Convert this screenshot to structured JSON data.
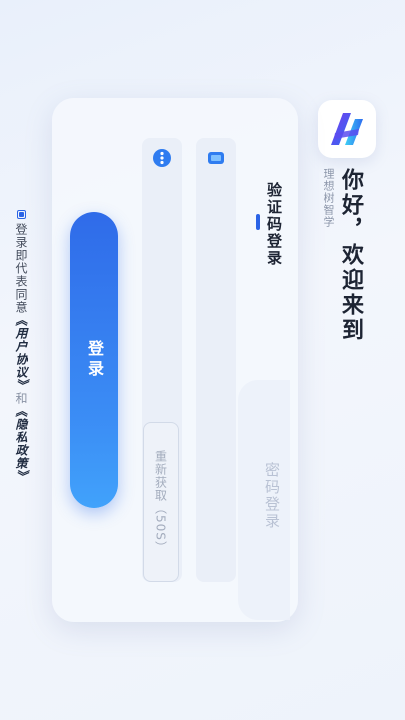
{
  "header": {
    "welcome": "你好，欢迎来到",
    "brand": "理想树智学"
  },
  "tabs": {
    "sms_login": "验证码登录",
    "password_login": "密码登录"
  },
  "form": {
    "phone_placeholder": "",
    "code_placeholder": "",
    "resend_label": "重新获取（50S）",
    "login_label": "登录"
  },
  "agreement": {
    "prefix": "登录即代表同意",
    "user_agreement": "《用户协议》",
    "and": "和",
    "privacy_policy": "《隐私政策》",
    "checked": true
  },
  "colors": {
    "accent": "#2a63e6",
    "button_gradient_start": "#2f6be9",
    "button_gradient_end": "#41a2fb"
  },
  "icons": {
    "logo": "app-logo-icon",
    "phone": "phone-icon",
    "code": "message-icon"
  }
}
